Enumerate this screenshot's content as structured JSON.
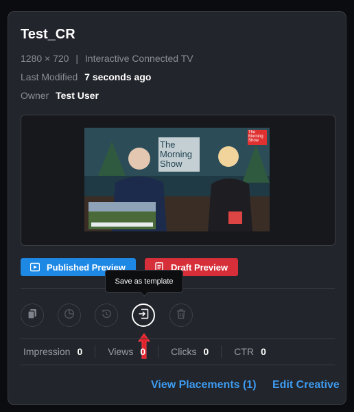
{
  "creative": {
    "title": "Test_CR",
    "dimensions": "1280 × 720",
    "separator": "|",
    "format": "Interactive Connected TV",
    "last_modified_label": "Last Modified",
    "last_modified_value": "7 seconds ago",
    "owner_label": "Owner",
    "owner_value": "Test User"
  },
  "thumbnail": {
    "show_title": "The Morning Show",
    "logo_text": "The Morning Show"
  },
  "buttons": {
    "published_preview": "Published Preview",
    "draft_preview": "Draft Preview"
  },
  "actions": {
    "tooltip": "Save as template",
    "icons": [
      "copy-icon",
      "report-icon",
      "history-icon",
      "save-as-template-icon",
      "delete-icon"
    ]
  },
  "stats": [
    {
      "label": "Impression",
      "value": "0"
    },
    {
      "label": "Views",
      "value": "0"
    },
    {
      "label": "Clicks",
      "value": "0"
    },
    {
      "label": "CTR",
      "value": "0"
    }
  ],
  "links": {
    "view_placements": "View Placements (1)",
    "edit_creative": "Edit Creative"
  },
  "colors": {
    "accent_blue": "#1e88e5",
    "accent_red": "#d62f3a",
    "link_blue": "#3d9bf0",
    "card_bg": "#22252b"
  }
}
